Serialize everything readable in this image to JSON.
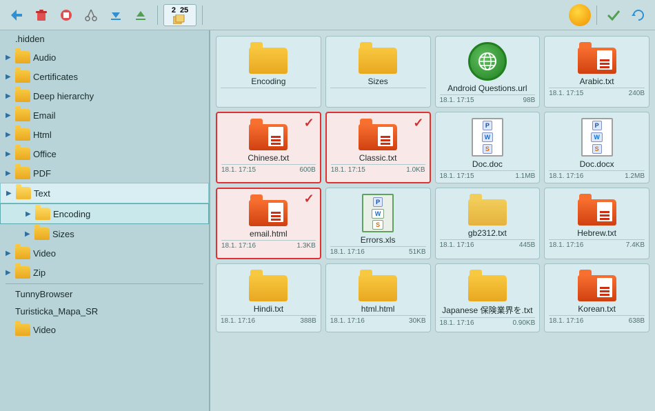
{
  "toolbar": {
    "buttons": [
      "⬆",
      "🗑",
      "🚫",
      "✂",
      "⬇",
      "⬆"
    ],
    "badge": {
      "top": "2",
      "bottom": "25"
    },
    "sun_btn_label": "sun",
    "check_btn": "✓",
    "refresh_btn": "↻"
  },
  "sidebar": {
    "items": [
      {
        "id": "hidden",
        "label": ".hidden",
        "indent": 0,
        "has_arrow": false,
        "has_folder": false
      },
      {
        "id": "audio",
        "label": "Audio",
        "indent": 0,
        "has_arrow": true
      },
      {
        "id": "certificates",
        "label": "Certificates",
        "indent": 0,
        "has_arrow": true
      },
      {
        "id": "deep-hierarchy",
        "label": "Deep hierarchy",
        "indent": 0,
        "has_arrow": true
      },
      {
        "id": "email",
        "label": "Email",
        "indent": 0,
        "has_arrow": true
      },
      {
        "id": "html",
        "label": "Html",
        "indent": 0,
        "has_arrow": true
      },
      {
        "id": "office",
        "label": "Office",
        "indent": 0,
        "has_arrow": true
      },
      {
        "id": "pdf",
        "label": "PDF",
        "indent": 0,
        "has_arrow": true
      },
      {
        "id": "text",
        "label": "Text",
        "indent": 0,
        "has_arrow": true,
        "selected": true
      },
      {
        "id": "encoding",
        "label": "Encoding",
        "indent": 1,
        "has_arrow": true,
        "selected": true
      },
      {
        "id": "sizes",
        "label": "Sizes",
        "indent": 1,
        "has_arrow": true
      },
      {
        "id": "video",
        "label": "Video",
        "indent": 0,
        "has_arrow": true
      },
      {
        "id": "zip",
        "label": "Zip",
        "indent": 0,
        "has_arrow": true
      },
      {
        "id": "tunny-browser",
        "label": "TunnyBrowser",
        "indent": 0,
        "has_arrow": false,
        "has_folder": false
      },
      {
        "id": "turisticka",
        "label": "Turisticka_Mapa_SR",
        "indent": 0,
        "has_arrow": false,
        "has_folder": false
      },
      {
        "id": "video2",
        "label": "Video",
        "indent": 0,
        "has_arrow": false
      }
    ]
  },
  "files": [
    {
      "id": "encoding-folder",
      "name": "Encoding",
      "type": "folder",
      "date": "",
      "size": "",
      "selected": false
    },
    {
      "id": "sizes-folder",
      "name": "Sizes",
      "type": "folder",
      "date": "",
      "size": "",
      "selected": false
    },
    {
      "id": "android-url",
      "name": "Android Questions.url",
      "type": "url",
      "date": "18.1. 17:15",
      "size": "98B",
      "selected": false
    },
    {
      "id": "arabic-txt",
      "name": "Arabic.txt",
      "type": "txt",
      "date": "18.1. 17:15",
      "size": "240B",
      "selected": false
    },
    {
      "id": "chinese-txt",
      "name": "Chinese.txt",
      "type": "doc-folder",
      "date": "18.1. 17:15",
      "size": "600B",
      "selected": true,
      "checkmark": true
    },
    {
      "id": "classic-txt",
      "name": "Classic.txt",
      "type": "doc-folder",
      "date": "18.1. 17:15",
      "size": "1.0KB",
      "selected": true,
      "checkmark": true
    },
    {
      "id": "doc-doc",
      "name": "Doc.doc",
      "type": "ws",
      "date": "18.1. 17:15",
      "size": "1.1MB",
      "selected": false
    },
    {
      "id": "doc-docx",
      "name": "Doc.docx",
      "type": "ws",
      "date": "18.1. 17:16",
      "size": "1.2MB",
      "selected": false
    },
    {
      "id": "email-html",
      "name": "email.html",
      "type": "doc-folder",
      "date": "18.1. 17:16",
      "size": "1.3KB",
      "selected": true,
      "checkmark": true
    },
    {
      "id": "errors-xls",
      "name": "Errors.xls",
      "type": "xls",
      "date": "18.1. 17:16",
      "size": "51KB",
      "selected": false
    },
    {
      "id": "gb2312-txt",
      "name": "gb2312.txt",
      "type": "folder-orange",
      "date": "18.1. 17:16",
      "size": "445B",
      "selected": false
    },
    {
      "id": "hebrew-txt",
      "name": "Hebrew.txt",
      "type": "doc-folder",
      "date": "18.1. 17:16",
      "size": "7.4KB",
      "selected": false
    },
    {
      "id": "hindi-txt",
      "name": "Hindi.txt",
      "type": "folder-orange",
      "date": "18.1. 17:16",
      "size": "388B",
      "selected": false
    },
    {
      "id": "html-html",
      "name": "html.html",
      "type": "folder-orange",
      "date": "18.1. 17:16",
      "size": "30KB",
      "selected": false
    },
    {
      "id": "japanese-txt",
      "name": "Japanese 保険業界を.txt",
      "type": "folder-orange",
      "date": "18.1. 17:16",
      "size": "0.90KB",
      "selected": false
    },
    {
      "id": "korean-txt",
      "name": "Korean.txt",
      "type": "doc-folder",
      "date": "18.1. 17:16",
      "size": "638B",
      "selected": false
    }
  ]
}
